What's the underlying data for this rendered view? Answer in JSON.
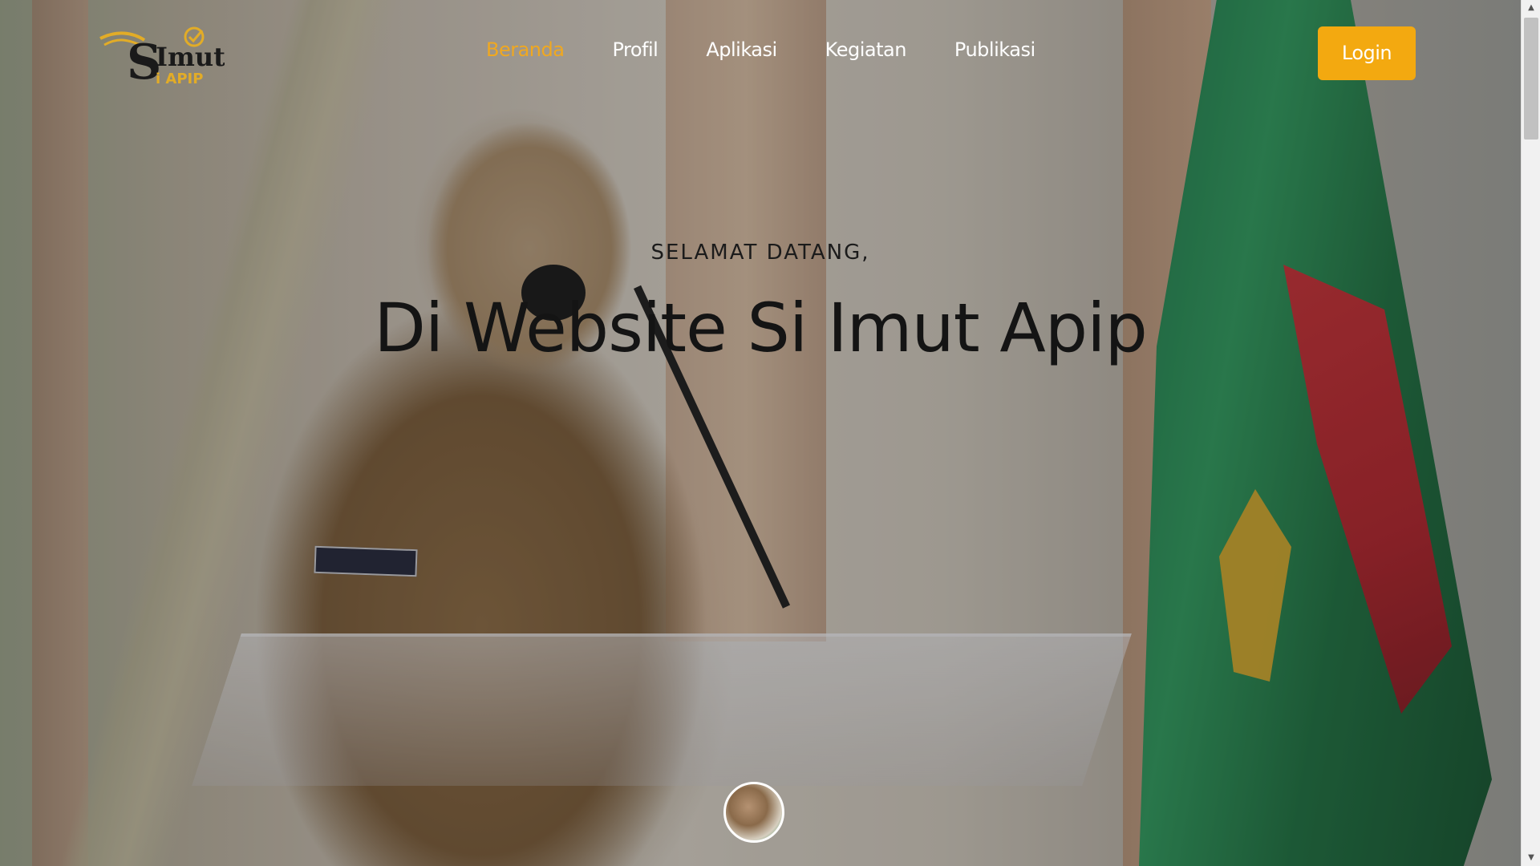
{
  "brand": {
    "logo_main": "SImut",
    "logo_sub": "i APIP"
  },
  "nav": {
    "items": [
      {
        "label": "Beranda",
        "active": true
      },
      {
        "label": "Profil",
        "active": false
      },
      {
        "label": "Aplikasi",
        "active": false
      },
      {
        "label": "Kegiatan",
        "active": false
      },
      {
        "label": "Publikasi",
        "active": false
      }
    ],
    "login_label": "Login"
  },
  "hero": {
    "greeting": "SELAMAT DATANG,",
    "headline": "Di Website Si Imut Apip"
  },
  "colors": {
    "accent": "#f3a910",
    "active_nav": "#f0a820",
    "nav_text": "#ffffff",
    "headline_text": "#141414"
  },
  "icons": {
    "logo_check": "checkmark-icon",
    "scroll_up": "arrow-up-icon",
    "scroll_down": "arrow-down-icon"
  }
}
